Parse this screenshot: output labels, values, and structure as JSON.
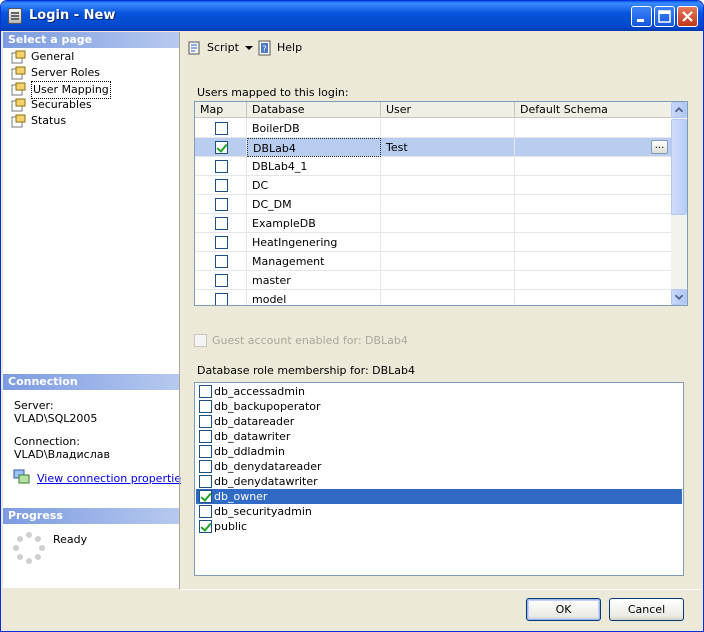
{
  "window": {
    "title": "Login - New"
  },
  "left": {
    "select_header": "Select a page",
    "pages": [
      {
        "label": "General"
      },
      {
        "label": "Server Roles"
      },
      {
        "label": "User Mapping"
      },
      {
        "label": "Securables"
      },
      {
        "label": "Status"
      }
    ],
    "connection_header": "Connection",
    "server_label": "Server:",
    "server_value": "VLAD\\SQL2005",
    "connection_label": "Connection:",
    "connection_value": "VLAD\\Владислав",
    "view_props_link": "View connection properties",
    "progress_header": "Progress",
    "progress_status": "Ready"
  },
  "toolbar": {
    "script_label": "Script",
    "help_label": "Help"
  },
  "mapping": {
    "label": "Users mapped to this login:",
    "columns": [
      "Map",
      "Database",
      "User",
      "Default Schema"
    ],
    "rows": [
      {
        "db": "BoilerDB",
        "user": "",
        "schema": "",
        "checked": false
      },
      {
        "db": "DBLab4",
        "user": "Test",
        "schema": "",
        "checked": true
      },
      {
        "db": "DBLab4_1",
        "user": "",
        "schema": "",
        "checked": false
      },
      {
        "db": "DC",
        "user": "",
        "schema": "",
        "checked": false
      },
      {
        "db": "DC_DM",
        "user": "",
        "schema": "",
        "checked": false
      },
      {
        "db": "ExampleDB",
        "user": "",
        "schema": "",
        "checked": false
      },
      {
        "db": "HeatIngenering",
        "user": "",
        "schema": "",
        "checked": false
      },
      {
        "db": "Management",
        "user": "",
        "schema": "",
        "checked": false
      },
      {
        "db": "master",
        "user": "",
        "schema": "",
        "checked": false
      },
      {
        "db": "model",
        "user": "",
        "schema": "",
        "checked": false
      }
    ],
    "ellipsis": "..."
  },
  "guest": {
    "label": "Guest account enabled for: DBLab4",
    "checked": false
  },
  "roles": {
    "label": "Database role membership for: DBLab4",
    "items": [
      {
        "name": "db_accessadmin",
        "checked": false
      },
      {
        "name": "db_backupoperator",
        "checked": false
      },
      {
        "name": "db_datareader",
        "checked": false
      },
      {
        "name": "db_datawriter",
        "checked": false
      },
      {
        "name": "db_ddladmin",
        "checked": false
      },
      {
        "name": "db_denydatareader",
        "checked": false
      },
      {
        "name": "db_denydatawriter",
        "checked": false
      },
      {
        "name": "db_owner",
        "checked": true
      },
      {
        "name": "db_securityadmin",
        "checked": false
      },
      {
        "name": "public",
        "checked": true
      }
    ]
  },
  "buttons": {
    "ok": "OK",
    "cancel": "Cancel"
  }
}
